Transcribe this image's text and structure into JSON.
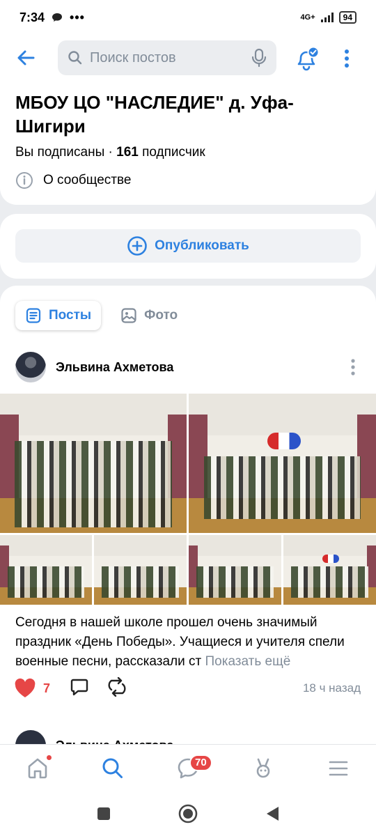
{
  "status_bar": {
    "time": "7:34",
    "network": "4G+",
    "battery": "94"
  },
  "search": {
    "placeholder": "Поиск постов"
  },
  "group": {
    "title": "МБОУ ЦО \"НАСЛЕДИЕ\" д. Уфа-Шигири",
    "subscribed": "Вы подписаны",
    "separator": " · ",
    "subscribers_count": "161",
    "subscribers_label": " подписчик",
    "about": "О сообществе"
  },
  "publish": {
    "label": "Опубликовать"
  },
  "tabs": [
    {
      "label": "Посты",
      "active": true
    },
    {
      "label": "Фото",
      "active": false
    }
  ],
  "post": {
    "author": "Эльвина Ахметова",
    "text": "Сегодня в нашей школе прошел очень значимый праздник «День Победы». Учащиеся и учителя спели военные песни, рассказали ст",
    "show_more": "Показать ещё",
    "likes": "7",
    "time": "18 ч назад"
  },
  "next_post": {
    "author": "Эльвина Ахметова"
  },
  "bottom_nav": {
    "messages_badge": "70",
    "items": [
      "home-icon",
      "search-icon",
      "messages-icon",
      "clips-icon",
      "menu-icon"
    ]
  },
  "colors": {
    "accent": "#2d81e0",
    "like": "#e64646",
    "secondary": "#818c99",
    "bg": "#ebedf0"
  }
}
